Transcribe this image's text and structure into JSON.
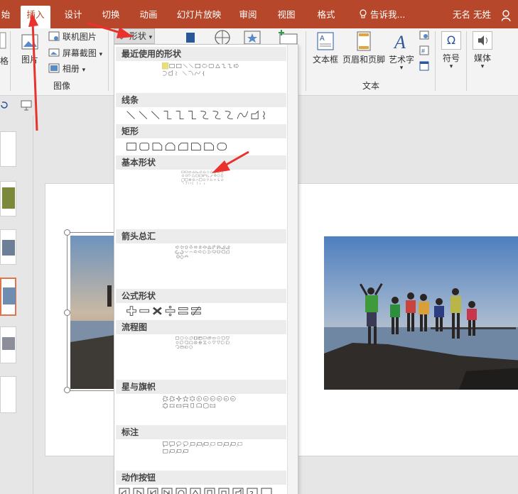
{
  "ribbon_tabs": {
    "partial_left": "始",
    "insert": "插入",
    "design": "设计",
    "transitions": "切换",
    "animations": "动画",
    "slideshow": "幻灯片放映",
    "review": "审阅",
    "view": "视图",
    "format": "格式",
    "tell_me": "告诉我...",
    "user": "无名 无姓"
  },
  "ribbon": {
    "left_partial_label": "格",
    "picture_label": "图片",
    "online_pictures": "联机图片",
    "screenshot": "屏幕截图",
    "album": "相册",
    "images_group": "图像",
    "shapes_button": "形状",
    "textbox": "文本框",
    "header_footer": "页眉和页脚",
    "wordart": "艺术字",
    "symbol": "符号",
    "media": "媒体",
    "text_group": "文本"
  },
  "shapes_menu": {
    "sections": [
      "最近使用的形状",
      "线条",
      "矩形",
      "基本形状",
      "箭头总汇",
      "公式形状",
      "流程图",
      "星与旗帜",
      "标注",
      "动作按钮"
    ]
  },
  "colors": {
    "accent": "#b7472a",
    "annotation_arrow": "#e8322b",
    "selected_slide_border": "#e0744f"
  }
}
